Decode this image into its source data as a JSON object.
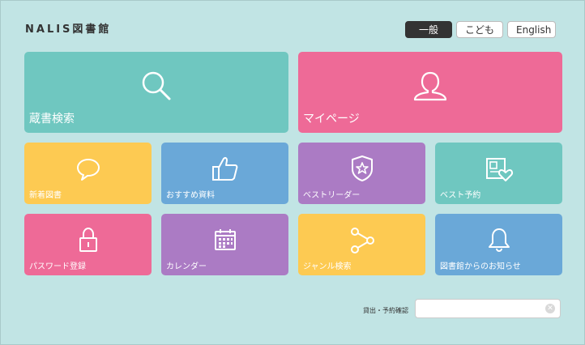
{
  "header": {
    "title": "NALIS図書館",
    "lang_buttons": [
      {
        "label": "一般",
        "active": true
      },
      {
        "label": "こども",
        "active": false
      },
      {
        "label": "English",
        "active": false
      }
    ]
  },
  "tiles": {
    "big": [
      {
        "label": "蔵書検索",
        "icon": "search-icon",
        "color": "#6fc7c0"
      },
      {
        "label": "マイページ",
        "icon": "user-icon",
        "color": "#ee6a97"
      }
    ],
    "row1": [
      {
        "label": "新着図書",
        "icon": "speech-bubble-icon",
        "color": "#fdca52"
      },
      {
        "label": "おすすめ資料",
        "icon": "thumbs-up-icon",
        "color": "#6aa8d8"
      },
      {
        "label": "ベストリーダー",
        "icon": "badge-star-icon",
        "color": "#ab7bc4"
      },
      {
        "label": "ベスト予約",
        "icon": "book-heart-icon",
        "color": "#6fc7c0"
      }
    ],
    "row2": [
      {
        "label": "パスワード登録",
        "icon": "lock-icon",
        "color": "#ee6a97"
      },
      {
        "label": "カレンダー",
        "icon": "calendar-icon",
        "color": "#ab7bc4"
      },
      {
        "label": "ジャンル検索",
        "icon": "share-icon",
        "color": "#fdca52"
      },
      {
        "label": "図書館からのお知らせ",
        "icon": "bell-icon",
        "color": "#6aa8d8"
      }
    ]
  },
  "loan_check": {
    "label": "貸出・予約確認",
    "value": "",
    "placeholder": ""
  }
}
